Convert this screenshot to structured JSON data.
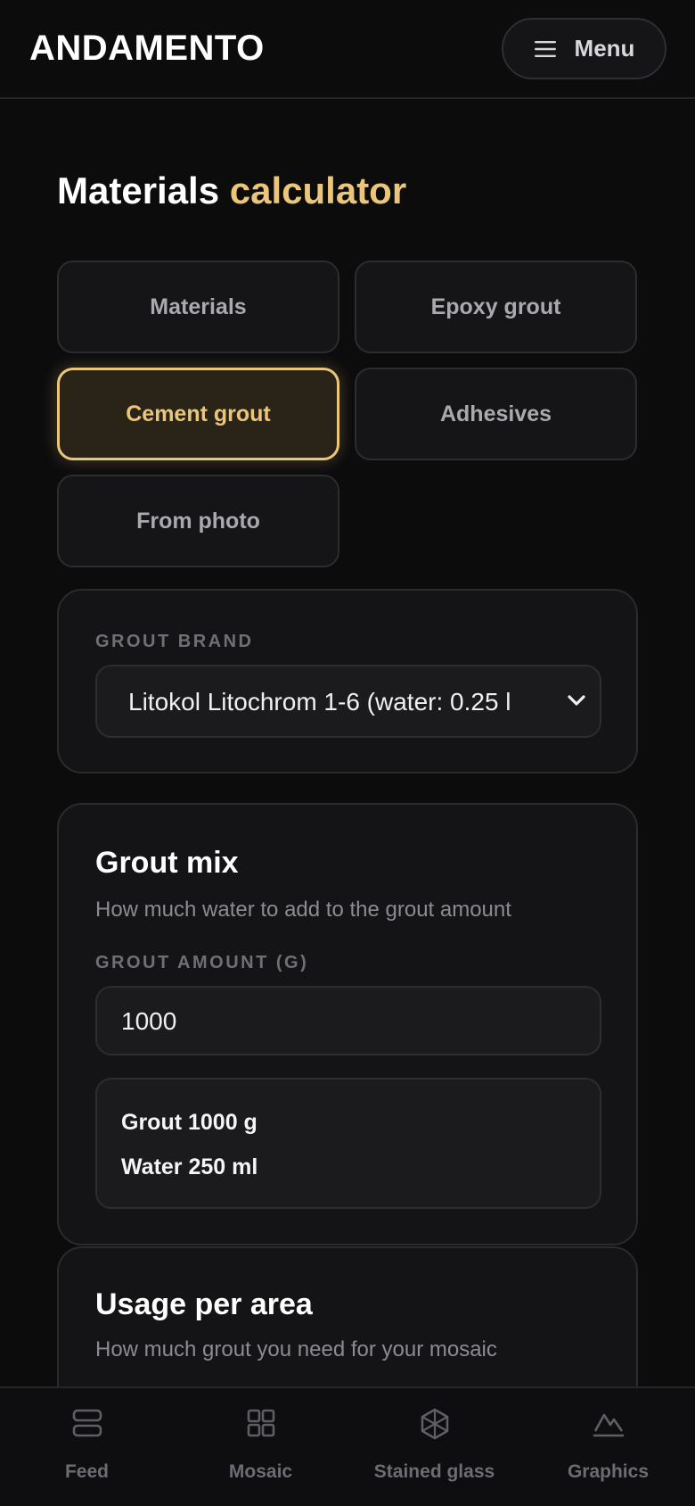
{
  "header": {
    "logo": "ANDAMENTO",
    "menu_label": "Menu"
  },
  "title": {
    "main": "Materials",
    "accent": "calculator",
    "accent_color": "#ebc57a"
  },
  "tabs": [
    {
      "label": "Materials",
      "active": false
    },
    {
      "label": "Epoxy grout",
      "active": false
    },
    {
      "label": "Cement grout",
      "active": true
    },
    {
      "label": "Adhesives",
      "active": false
    },
    {
      "label": "From photo",
      "active": false
    }
  ],
  "brand_card": {
    "label": "GROUT BRAND",
    "selected": "Litokol Litochrom 1-6 (water: 0.25 l"
  },
  "mix_card": {
    "title": "Grout mix",
    "subtitle": "How much water to add to the grout amount",
    "amount_label": "GROUT AMOUNT (G)",
    "amount_value": "1000",
    "result_grout": "Grout 1000 g",
    "result_water": "Water 250 ml"
  },
  "usage_card": {
    "title": "Usage per area",
    "subtitle": "How much grout you need for your mosaic"
  },
  "bottom_nav": [
    {
      "label": "Feed",
      "icon": "feed-icon"
    },
    {
      "label": "Mosaic",
      "icon": "mosaic-icon"
    },
    {
      "label": "Stained glass",
      "icon": "stained-glass-icon"
    },
    {
      "label": "Graphics",
      "icon": "graphics-icon"
    }
  ]
}
